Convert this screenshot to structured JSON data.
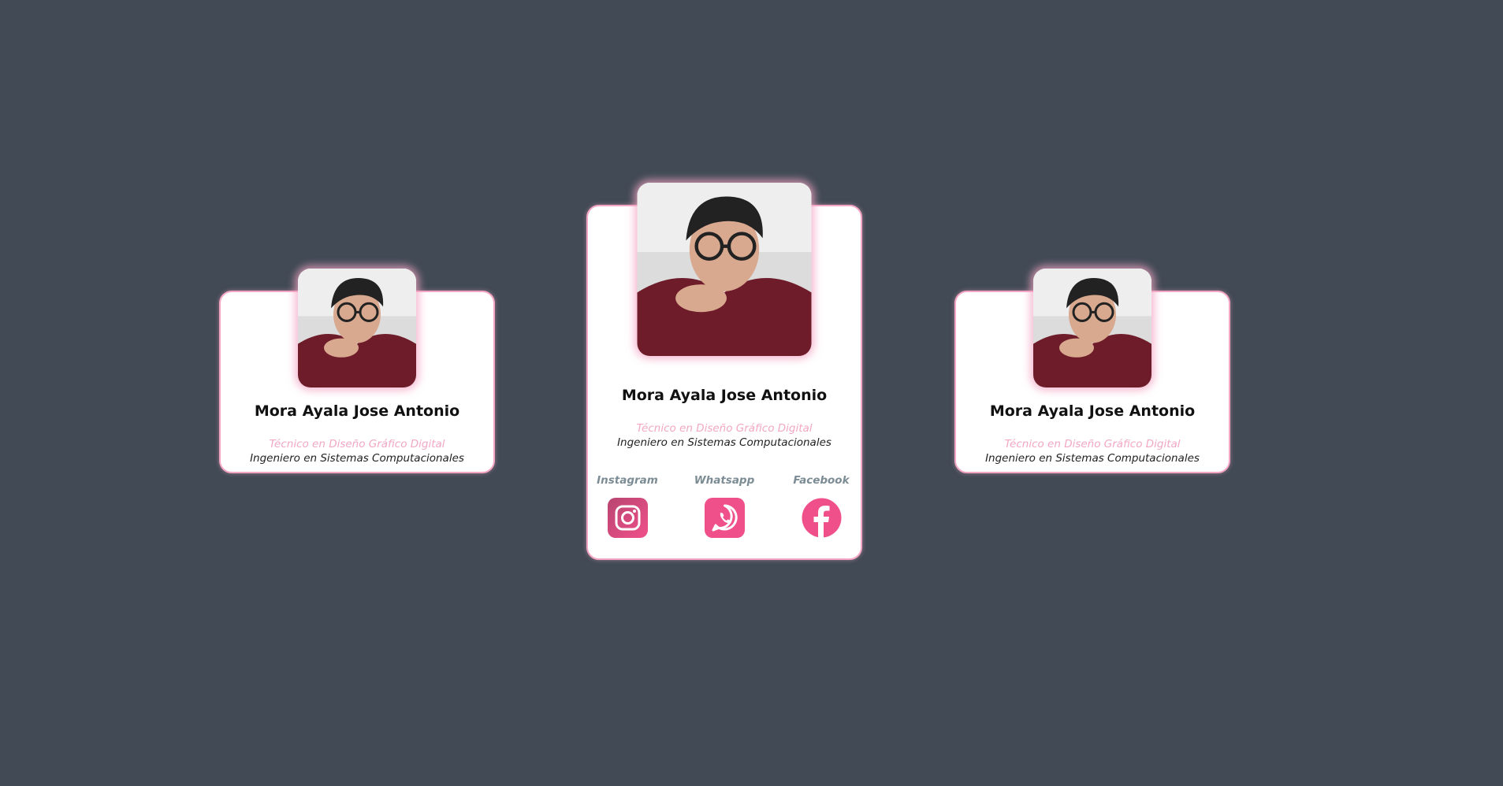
{
  "colors": {
    "background": "#414a55",
    "card_border": "#f3a6c4",
    "accent_pink": "#f2a7c3",
    "social_label": "#7c8c94",
    "icon_pink": "#f0508a"
  },
  "cards": [
    {
      "name": "Mora Ayala Jose Antonio",
      "role_primary": "Técnico en Diseño Gráfico Digital",
      "role_secondary": "Ingeniero en Sistemas Computacionales"
    },
    {
      "name": "Mora Ayala Jose Antonio",
      "role_primary": "Técnico en Diseño Gráfico Digital",
      "role_secondary": "Ingeniero en Sistemas Computacionales",
      "socials": [
        {
          "label": "Instagram",
          "icon": "instagram-icon"
        },
        {
          "label": "Whatsapp",
          "icon": "whatsapp-icon"
        },
        {
          "label": "Facebook",
          "icon": "facebook-icon"
        }
      ]
    },
    {
      "name": "Mora Ayala Jose Antonio",
      "role_primary": "Técnico en Diseño Gráfico Digital",
      "role_secondary": "Ingeniero en Sistemas Computacionales"
    }
  ]
}
